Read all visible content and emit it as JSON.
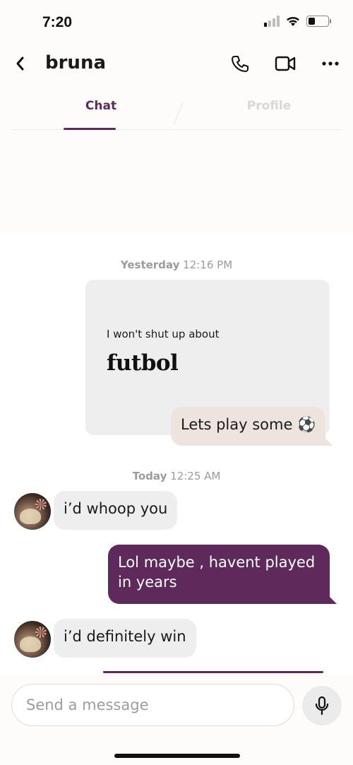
{
  "status_bar": {
    "time": "7:20"
  },
  "header": {
    "title": "bruna"
  },
  "tabs": [
    {
      "label": "Chat",
      "active": true
    },
    {
      "label": "Profile",
      "active": false
    }
  ],
  "separators": [
    {
      "day": "Yesterday",
      "time": "12:16 PM"
    },
    {
      "day": "Today",
      "time": "12:25 AM"
    }
  ],
  "prompt_card": {
    "question": "I won't shut up about",
    "answer": "futbol"
  },
  "messages": [
    {
      "side": "outgoing",
      "kind": "prompt-reply",
      "text": "Lets play some ⚽"
    },
    {
      "side": "incoming",
      "text": "i’d whoop you"
    },
    {
      "side": "outgoing",
      "text": "Lol maybe , havent played in years"
    },
    {
      "side": "incoming",
      "text": "i’d definitely win"
    }
  ],
  "composer": {
    "placeholder": "Send a message"
  },
  "colors": {
    "accent": "#5e2a5c",
    "incoming_bubble": "#eeeeee",
    "reply_bubble": "#ede4dd",
    "muted_text": "#9b9b9b"
  },
  "icons": [
    "back-chevron-icon",
    "phone-icon",
    "video-camera-icon",
    "more-dots-icon",
    "mic-icon",
    "signal-icon",
    "wifi-icon",
    "battery-icon"
  ]
}
